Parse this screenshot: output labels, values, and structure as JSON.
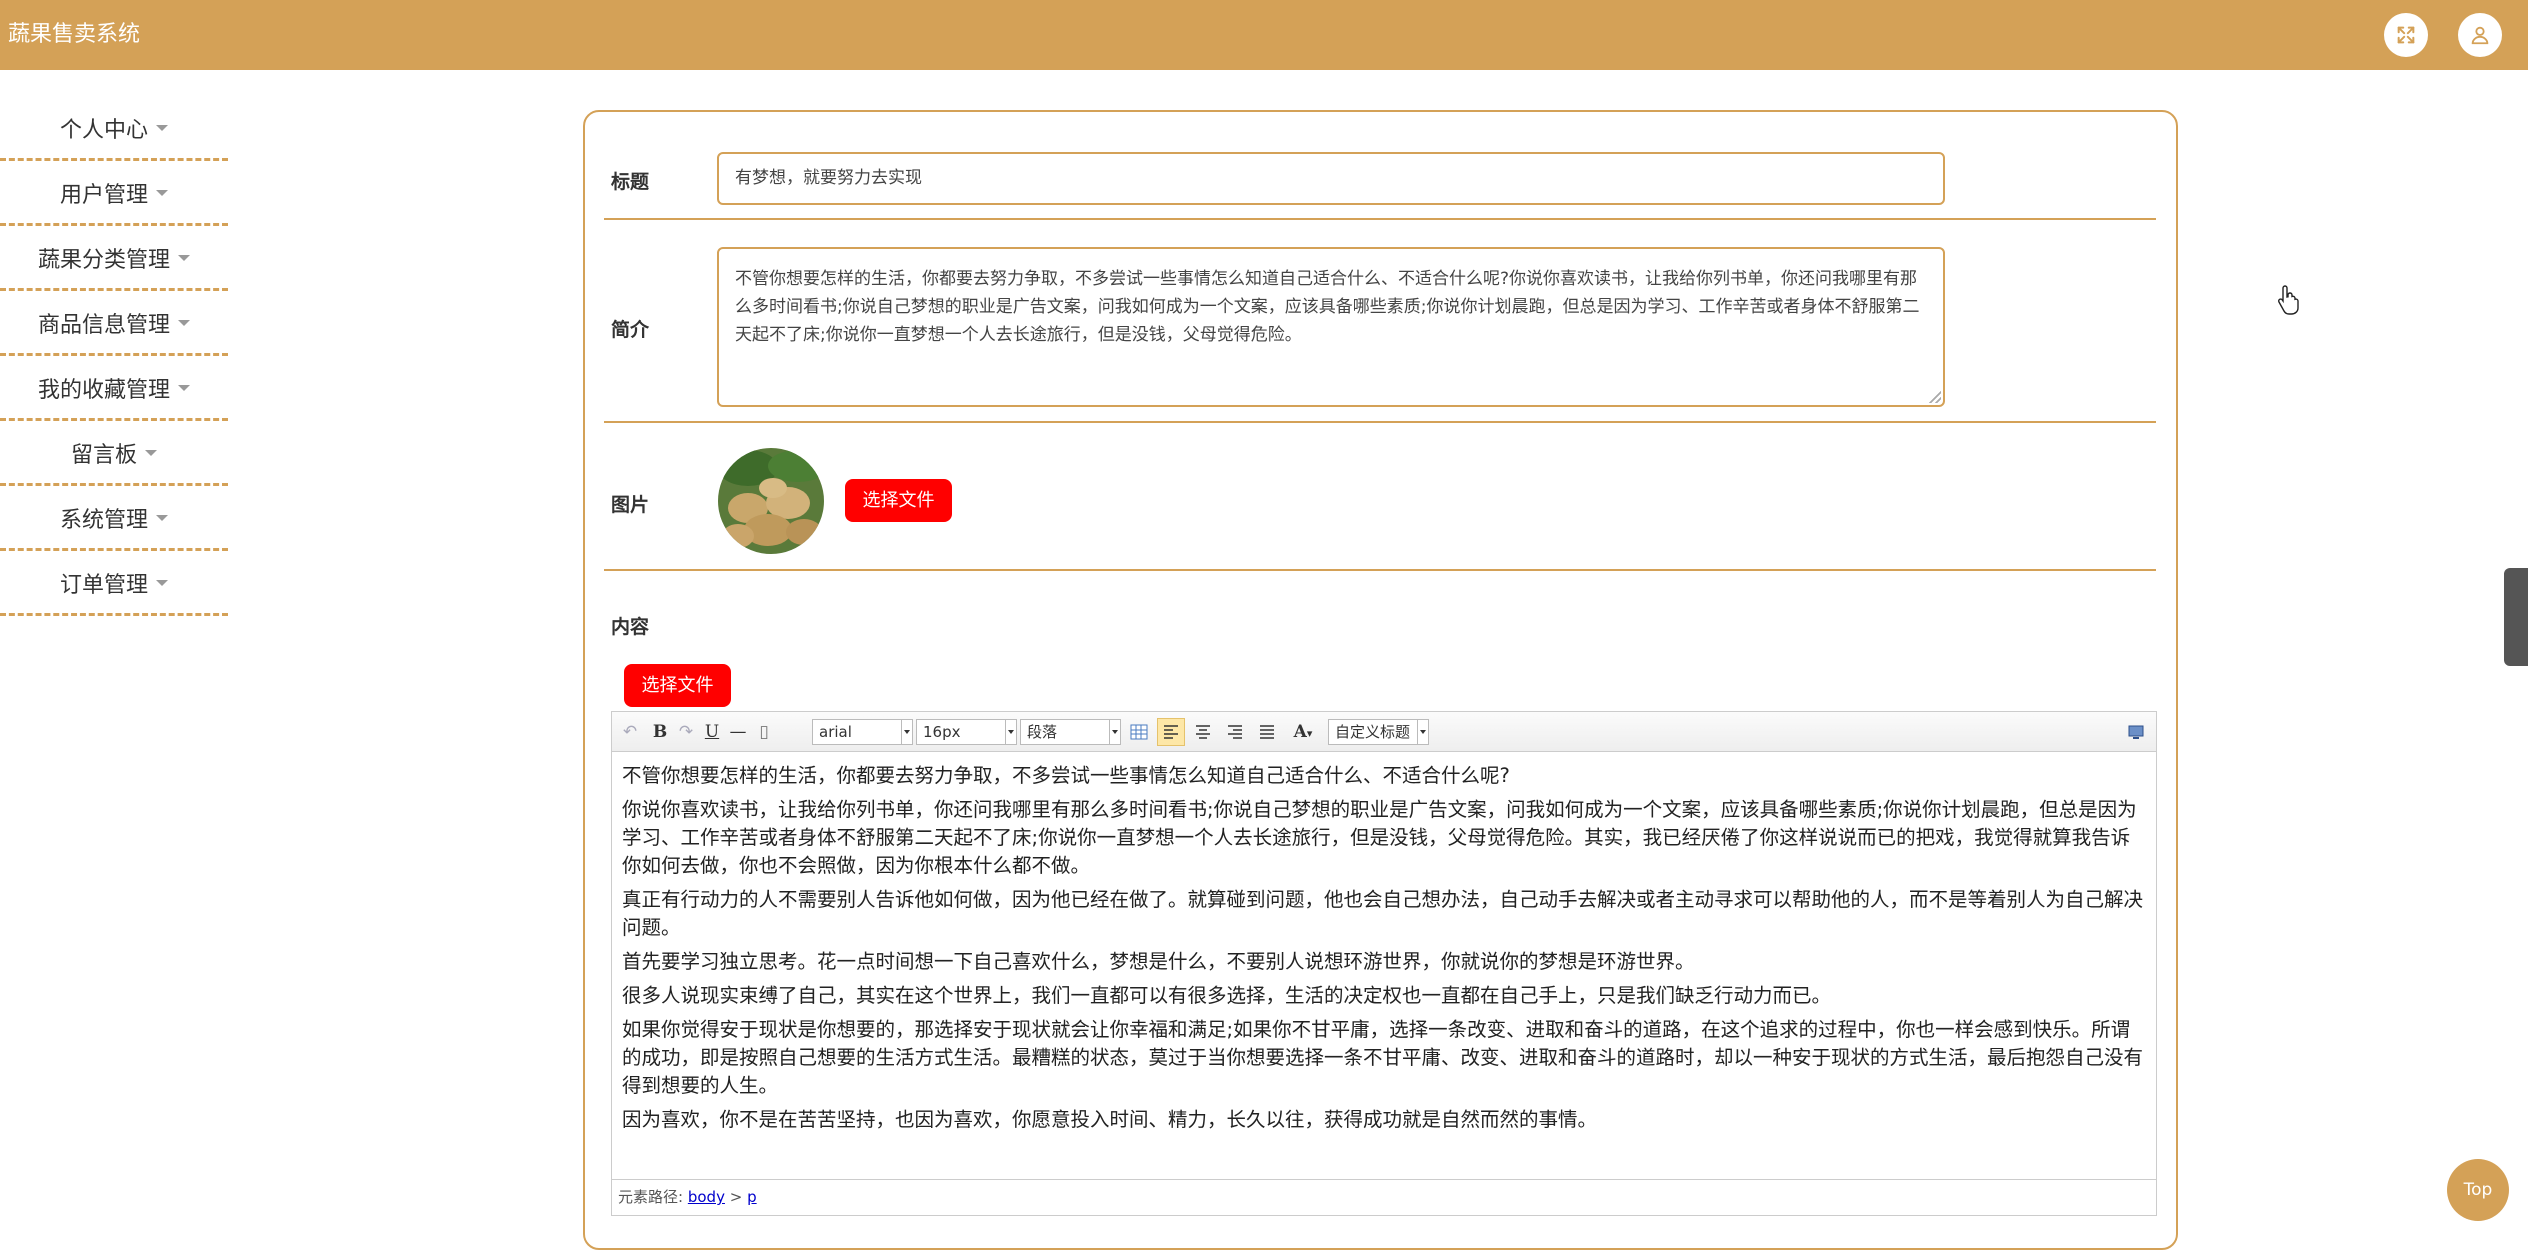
{
  "app": {
    "title": "蔬果售卖系统"
  },
  "header": {
    "fullscreen_icon": "fullscreen-icon",
    "user_icon": "user-icon"
  },
  "sidebar": {
    "items": [
      {
        "label": "个人中心"
      },
      {
        "label": "用户管理"
      },
      {
        "label": "蔬果分类管理"
      },
      {
        "label": "商品信息管理"
      },
      {
        "label": "我的收藏管理"
      },
      {
        "label": "留言板"
      },
      {
        "label": "系统管理"
      },
      {
        "label": "订单管理"
      }
    ]
  },
  "form": {
    "title_label": "标题",
    "title_value": "有梦想，就要努力去实现",
    "intro_label": "简介",
    "intro_value": "不管你想要怎样的生活，你都要去努力争取，不多尝试一些事情怎么知道自己适合什么、不适合什么呢?你说你喜欢读书，让我给你列书单，你还问我哪里有那么多时间看书;你说自己梦想的职业是广告文案，问我如何成为一个文案，应该具备哪些素质;你说你计划晨跑，但总是因为学习、工作辛苦或者身体不舒服第二天起不了床;你说你一直梦想一个人去长途旅行，但是没钱，父母觉得危险。",
    "image_label": "图片",
    "image_button": "选择文件",
    "content_label": "内容",
    "content_button": "选择文件"
  },
  "editor": {
    "toolbar": {
      "font_family": "arial",
      "font_size": "16px",
      "paragraph": "段落",
      "custom_title": "自定义标题",
      "bold": "B",
      "underline": "U",
      "font_color": "A"
    },
    "paragraphs": [
      "不管你想要怎样的生活，你都要去努力争取，不多尝试一些事情怎么知道自己适合什么、不适合什么呢?",
      "你说你喜欢读书，让我给你列书单，你还问我哪里有那么多时间看书;你说自己梦想的职业是广告文案，问我如何成为一个文案，应该具备哪些素质;你说你计划晨跑，但总是因为学习、工作辛苦或者身体不舒服第二天起不了床;你说你一直梦想一个人去长途旅行，但是没钱，父母觉得危险。其实，我已经厌倦了你这样说说而已的把戏，我觉得就算我告诉你如何去做，你也不会照做，因为你根本什么都不做。",
      "真正有行动力的人不需要别人告诉他如何做，因为他已经在做了。就算碰到问题，他也会自己想办法，自己动手去解决或者主动寻求可以帮助他的人，而不是等着别人为自己解决问题。",
      "首先要学习独立思考。花一点时间想一下自己喜欢什么，梦想是什么，不要别人说想环游世界，你就说你的梦想是环游世界。",
      "很多人说现实束缚了自己，其实在这个世界上，我们一直都可以有很多选择，生活的决定权也一直都在自己手上，只是我们缺乏行动力而已。",
      "如果你觉得安于现状是你想要的，那选择安于现状就会让你幸福和满足;如果你不甘平庸，选择一条改变、进取和奋斗的道路，在这个追求的过程中，你也一样会感到快乐。所谓的成功，即是按照自己想要的生活方式生活。最糟糕的状态，莫过于当你想要选择一条不甘平庸、改变、进取和奋斗的道路时，却以一种安于现状的方式生活，最后抱怨自己没有得到想要的人生。",
      "因为喜欢，你不是在苦苦坚持，也因为喜欢，你愿意投入时间、精力，长久以往，获得成功就是自然而然的事情。"
    ],
    "path_label": "元素路径:",
    "path_body": "body",
    "path_sep": ">",
    "path_p": "p"
  },
  "back_to_top": "Top",
  "colors": {
    "accent": "#d4a157",
    "button_red": "#ff0000"
  }
}
